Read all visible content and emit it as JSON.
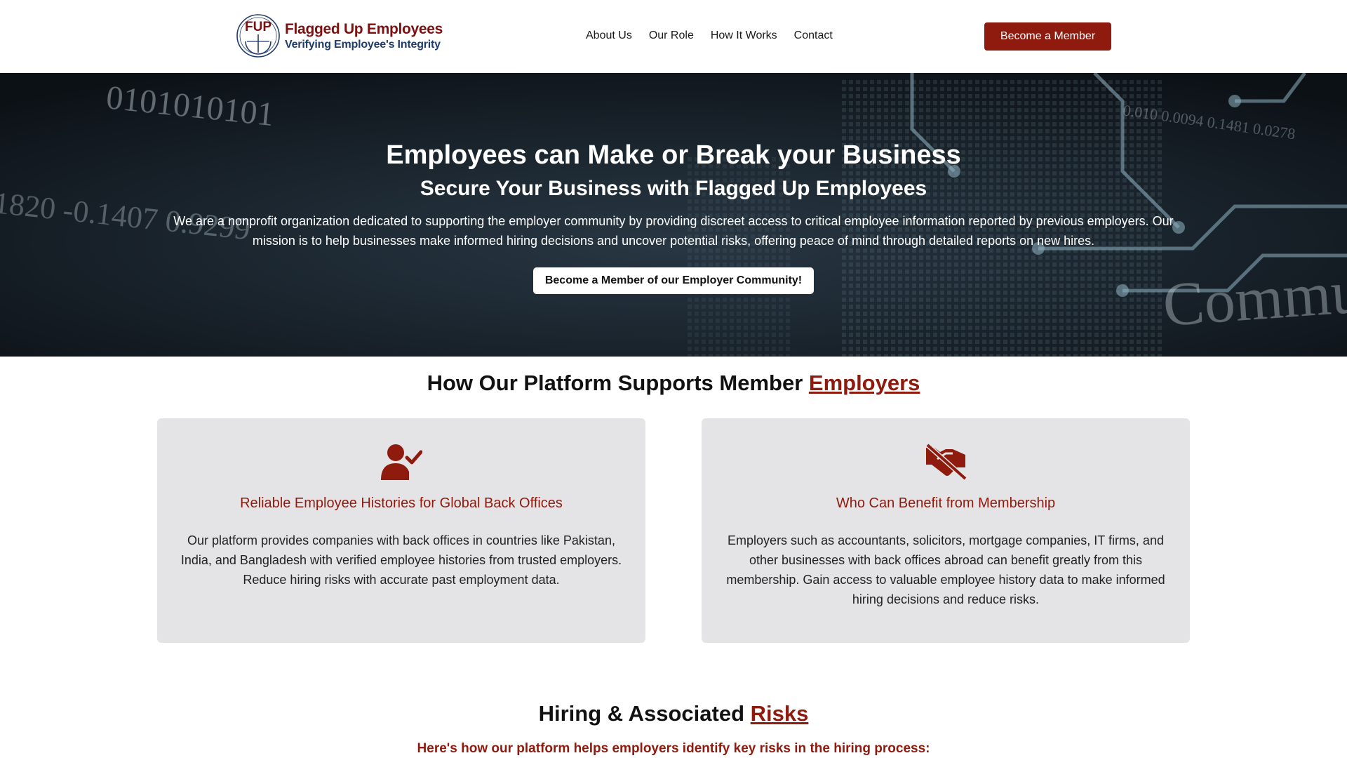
{
  "brand": {
    "logo_letters": "FUP",
    "name": "Flagged Up Employees",
    "tagline": "Verifying Employee's Integrity"
  },
  "nav": {
    "items": [
      "About Us",
      "Our Role",
      "How It Works",
      "Contact"
    ],
    "cta": "Become a Member"
  },
  "hero": {
    "title": "Employees can Make or Break your Business",
    "subtitle": "Secure Your Business with Flagged Up Employees",
    "description": "We are a nonprofit organization dedicated to supporting the employer community by providing discreet access to critical employee information reported by previous employers. Our mission is to help businesses make informed hiring decisions and uncover potential risks, offering peace of mind through detailed reports on new hires.",
    "button": "Become a Member of our Employer Community!",
    "bg_text": [
      "0101010101",
      "1820 -0.1407 0.9299",
      "0.010 0.0094 0.1481 0.0278",
      "Commu"
    ]
  },
  "platform": {
    "title_prefix": "How Our Platform Supports Member",
    "title_accent": "Employers",
    "cards": [
      {
        "icon": "user-check-icon",
        "title": "Reliable Employee Histories for Global Back Offices",
        "body": "Our platform provides companies with back offices in countries like Pakistan, India, and Bangladesh with verified employee histories from trusted employers. Reduce hiring risks with accurate past employment data."
      },
      {
        "icon": "handshake-slash-icon",
        "title": "Who Can Benefit from Membership",
        "body": "Employers such as accountants, solicitors, mortgage companies, IT firms, and other businesses with back offices abroad can benefit greatly from this membership. Gain access to valuable employee history data to make informed hiring decisions and reduce risks."
      }
    ]
  },
  "risks": {
    "title_prefix": "Hiring & Associated",
    "title_accent": "Risks",
    "subtitle": "Here's how our platform helps employers identify key risks in the hiring process:"
  },
  "colors": {
    "accent": "#8f1a0e",
    "brand_blue": "#1f3c6e",
    "card_bg": "#e4e4e6"
  }
}
